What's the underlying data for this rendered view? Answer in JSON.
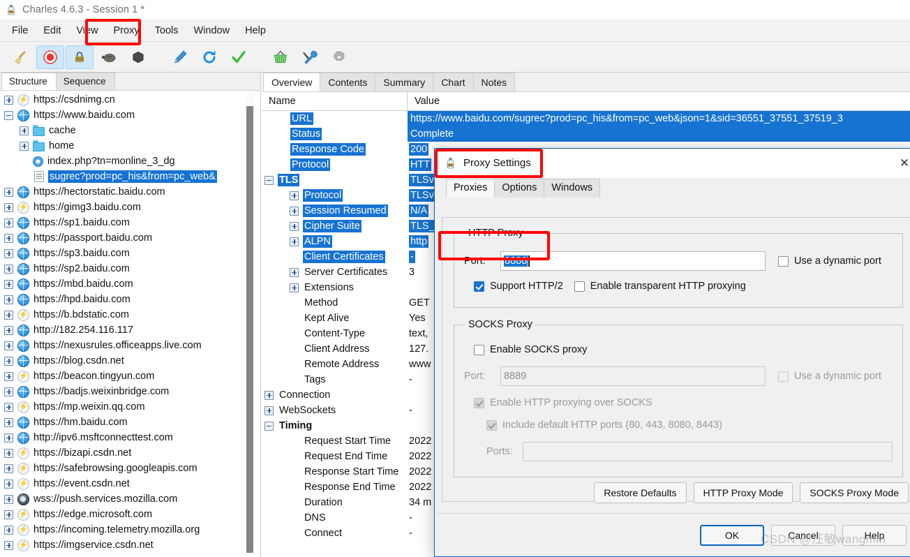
{
  "window": {
    "title": "Charles 4.6.3 - Session 1 *",
    "icon": "charles-bottle-icon"
  },
  "menubar": {
    "items": [
      {
        "label": "File",
        "name": "menu-file"
      },
      {
        "label": "Edit",
        "name": "menu-edit"
      },
      {
        "label": "View",
        "name": "menu-view"
      },
      {
        "label": "Proxy",
        "name": "menu-proxy",
        "highlighted": true
      },
      {
        "label": "Tools",
        "name": "menu-tools"
      },
      {
        "label": "Window",
        "name": "menu-window"
      },
      {
        "label": "Help",
        "name": "menu-help"
      }
    ]
  },
  "toolbar": {
    "buttons": [
      {
        "icon": "broom-icon",
        "glyph": "🧹",
        "active": false
      },
      {
        "icon": "record-icon",
        "glyph": "⏺",
        "active": true
      },
      {
        "icon": "ssl-lock-icon",
        "glyph": "🔒",
        "active": true
      },
      {
        "icon": "throttle-turtle-icon",
        "glyph": "🐢",
        "active": false
      },
      {
        "icon": "breakpoint-hexagon-icon",
        "glyph": "⬣",
        "active": false
      },
      {
        "icon": "compose-pen-icon",
        "glyph": "🖊",
        "active": false
      },
      {
        "icon": "repeat-refresh-icon",
        "glyph": "⟳",
        "active": false
      },
      {
        "icon": "validate-check-icon",
        "glyph": "✔",
        "active": false
      },
      {
        "icon": "basket-icon",
        "glyph": "🧺",
        "active": false
      },
      {
        "icon": "tools-wrench-icon",
        "glyph": "🛠",
        "active": false
      },
      {
        "icon": "settings-gear-icon",
        "glyph": "⚙",
        "active": false
      }
    ]
  },
  "left_panel": {
    "tabs": [
      {
        "label": "Structure",
        "selected": true
      },
      {
        "label": "Sequence",
        "selected": false
      }
    ],
    "tree": [
      {
        "label": "https://csdnimg.cn",
        "indent": 0,
        "twisty": "plus",
        "icon": "bolt",
        "selected": false
      },
      {
        "label": "https://www.baidu.com",
        "indent": 0,
        "twisty": "minus",
        "icon": "globe",
        "selected": false
      },
      {
        "label": "cache",
        "indent": 1,
        "twisty": "plus",
        "icon": "folder",
        "selected": false
      },
      {
        "label": "home",
        "indent": 1,
        "twisty": "plus",
        "icon": "folder",
        "selected": false
      },
      {
        "label": "index.php?tn=monline_3_dg",
        "indent": 1,
        "twisty": "none",
        "icon": "cd",
        "selected": false
      },
      {
        "label": "sugrec?prod=pc_his&from=pc_web&",
        "indent": 1,
        "twisty": "none",
        "icon": "doc",
        "selected": true
      },
      {
        "label": "https://hectorstatic.baidu.com",
        "indent": 0,
        "twisty": "plus",
        "icon": "globe",
        "selected": false
      },
      {
        "label": "https://gimg3.baidu.com",
        "indent": 0,
        "twisty": "plus",
        "icon": "bolt",
        "selected": false
      },
      {
        "label": "https://sp1.baidu.com",
        "indent": 0,
        "twisty": "plus",
        "icon": "globe",
        "selected": false
      },
      {
        "label": "https://passport.baidu.com",
        "indent": 0,
        "twisty": "plus",
        "icon": "globe",
        "selected": false
      },
      {
        "label": "https://sp3.baidu.com",
        "indent": 0,
        "twisty": "plus",
        "icon": "globe",
        "selected": false
      },
      {
        "label": "https://sp2.baidu.com",
        "indent": 0,
        "twisty": "plus",
        "icon": "globe",
        "selected": false
      },
      {
        "label": "https://mbd.baidu.com",
        "indent": 0,
        "twisty": "plus",
        "icon": "globe",
        "selected": false
      },
      {
        "label": "https://hpd.baidu.com",
        "indent": 0,
        "twisty": "plus",
        "icon": "globe",
        "selected": false
      },
      {
        "label": "https://b.bdstatic.com",
        "indent": 0,
        "twisty": "plus",
        "icon": "bolt",
        "selected": false
      },
      {
        "label": "http://182.254.116.117",
        "indent": 0,
        "twisty": "plus",
        "icon": "globe",
        "selected": false
      },
      {
        "label": "https://nexusrules.officeapps.live.com",
        "indent": 0,
        "twisty": "plus",
        "icon": "globe",
        "selected": false
      },
      {
        "label": "https://blog.csdn.net",
        "indent": 0,
        "twisty": "plus",
        "icon": "globe",
        "selected": false
      },
      {
        "label": "https://beacon.tingyun.com",
        "indent": 0,
        "twisty": "plus",
        "icon": "bolt",
        "selected": false
      },
      {
        "label": "https://badjs.weixinbridge.com",
        "indent": 0,
        "twisty": "plus",
        "icon": "globe",
        "selected": false
      },
      {
        "label": "https://mp.weixin.qq.com",
        "indent": 0,
        "twisty": "plus",
        "icon": "bolt",
        "selected": false
      },
      {
        "label": "https://hm.baidu.com",
        "indent": 0,
        "twisty": "plus",
        "icon": "globe",
        "selected": false
      },
      {
        "label": "http://ipv6.msftconnecttest.com",
        "indent": 0,
        "twisty": "plus",
        "icon": "globe",
        "selected": false
      },
      {
        "label": "https://bizapi.csdn.net",
        "indent": 0,
        "twisty": "plus",
        "icon": "bolt",
        "selected": false
      },
      {
        "label": "https://safebrowsing.googleapis.com",
        "indent": 0,
        "twisty": "plus",
        "icon": "bolt",
        "selected": false
      },
      {
        "label": "https://event.csdn.net",
        "indent": 0,
        "twisty": "plus",
        "icon": "bolt",
        "selected": false
      },
      {
        "label": "wss://push.services.mozilla.com",
        "indent": 0,
        "twisty": "plus",
        "icon": "ws",
        "selected": false
      },
      {
        "label": "https://edge.microsoft.com",
        "indent": 0,
        "twisty": "plus",
        "icon": "bolt",
        "selected": false
      },
      {
        "label": "https://incoming.telemetry.mozilla.org",
        "indent": 0,
        "twisty": "plus",
        "icon": "bolt",
        "selected": false
      },
      {
        "label": "https://imgservice.csdn.net",
        "indent": 0,
        "twisty": "plus",
        "icon": "bolt",
        "selected": false
      }
    ]
  },
  "right_panel": {
    "tabs": [
      {
        "label": "Overview",
        "selected": true
      },
      {
        "label": "Contents",
        "selected": false
      },
      {
        "label": "Summary",
        "selected": false
      },
      {
        "label": "Chart",
        "selected": false
      },
      {
        "label": "Notes",
        "selected": false
      }
    ],
    "columns": {
      "name": "Name",
      "value": "Value"
    },
    "rows": [
      {
        "name": "URL",
        "value": "https://www.baidu.com/sugrec?prod=pc_his&from=pc_web&json=1&sid=36551_37551_37519_3",
        "indent": 1,
        "twisty": "none",
        "highlighted": true,
        "bold": false
      },
      {
        "name": "Status",
        "value": "Complete",
        "indent": 1,
        "twisty": "none",
        "highlighted": true,
        "bold": false
      },
      {
        "name": "Response Code",
        "value": "200",
        "indent": 1,
        "twisty": "none",
        "highlighted": true,
        "bold": false
      },
      {
        "name": "Protocol",
        "value": "HTT",
        "indent": 1,
        "twisty": "none",
        "highlighted": true,
        "bold": false
      },
      {
        "name": "TLS",
        "value": "TLSv",
        "indent": 0,
        "twisty": "minus",
        "highlighted": true,
        "bold": true
      },
      {
        "name": "Protocol",
        "value": "TLSv",
        "indent": 2,
        "twisty": "plus",
        "highlighted": true,
        "bold": false
      },
      {
        "name": "Session Resumed",
        "value": "N/A",
        "indent": 2,
        "twisty": "plus",
        "highlighted": true,
        "bold": false
      },
      {
        "name": "Cipher Suite",
        "value": "TLS_",
        "indent": 2,
        "twisty": "plus",
        "highlighted": true,
        "bold": false
      },
      {
        "name": "ALPN",
        "value": "http",
        "indent": 2,
        "twisty": "plus",
        "highlighted": true,
        "bold": false
      },
      {
        "name": "Client Certificates",
        "value": "-",
        "indent": 2,
        "twisty": "none",
        "highlighted": true,
        "bold": false
      },
      {
        "name": "Server Certificates",
        "value": "3",
        "indent": 2,
        "twisty": "plus",
        "highlighted": false,
        "bold": false
      },
      {
        "name": "Extensions",
        "value": "",
        "indent": 2,
        "twisty": "plus",
        "highlighted": false,
        "bold": false
      },
      {
        "name": "Method",
        "value": "GET",
        "indent": 2,
        "twisty": "none",
        "highlighted": false,
        "bold": false
      },
      {
        "name": "Kept Alive",
        "value": "Yes",
        "indent": 2,
        "twisty": "none",
        "highlighted": false,
        "bold": false
      },
      {
        "name": "Content-Type",
        "value": "text,",
        "indent": 2,
        "twisty": "none",
        "highlighted": false,
        "bold": false
      },
      {
        "name": "Client Address",
        "value": "127.",
        "indent": 2,
        "twisty": "none",
        "highlighted": false,
        "bold": false
      },
      {
        "name": "Remote Address",
        "value": "www",
        "indent": 2,
        "twisty": "none",
        "highlighted": false,
        "bold": false
      },
      {
        "name": "Tags",
        "value": "-",
        "indent": 2,
        "twisty": "none",
        "highlighted": false,
        "bold": false
      },
      {
        "name": "Connection",
        "value": "",
        "indent": 0,
        "twisty": "plus",
        "highlighted": false,
        "bold": false
      },
      {
        "name": "WebSockets",
        "value": "-",
        "indent": 0,
        "twisty": "plus",
        "highlighted": false,
        "bold": false
      },
      {
        "name": "Timing",
        "value": "",
        "indent": 0,
        "twisty": "minus",
        "highlighted": false,
        "bold": true
      },
      {
        "name": "Request Start Time",
        "value": "2022",
        "indent": 2,
        "twisty": "none",
        "highlighted": false,
        "bold": false
      },
      {
        "name": "Request End Time",
        "value": "2022",
        "indent": 2,
        "twisty": "none",
        "highlighted": false,
        "bold": false
      },
      {
        "name": "Response Start Time",
        "value": "2022",
        "indent": 2,
        "twisty": "none",
        "highlighted": false,
        "bold": false
      },
      {
        "name": "Response End Time",
        "value": "2022",
        "indent": 2,
        "twisty": "none",
        "highlighted": false,
        "bold": false
      },
      {
        "name": "Duration",
        "value": "34 m",
        "indent": 2,
        "twisty": "none",
        "highlighted": false,
        "bold": false
      },
      {
        "name": "DNS",
        "value": "-",
        "indent": 2,
        "twisty": "none",
        "highlighted": false,
        "bold": false
      },
      {
        "name": "Connect",
        "value": "-",
        "indent": 2,
        "twisty": "none",
        "highlighted": false,
        "bold": false
      }
    ]
  },
  "dialog": {
    "title": "Proxy Settings",
    "icon": "charles-bottle-icon",
    "close_label": "✕",
    "tabs": [
      {
        "label": "Proxies",
        "selected": true
      },
      {
        "label": "Options",
        "selected": false
      },
      {
        "label": "Windows",
        "selected": false
      }
    ],
    "http_proxy": {
      "legend": "HTTP Proxy",
      "port_label": "Port:",
      "port_value": "8888",
      "port_selected": true,
      "dynamic_port_label": "Use a dynamic port",
      "dynamic_port_checked": false,
      "support_http2_label": "Support HTTP/2",
      "support_http2_checked": true,
      "transparent_label": "Enable transparent HTTP proxying",
      "transparent_checked": false
    },
    "socks_proxy": {
      "legend": "SOCKS Proxy",
      "enable_label": "Enable SOCKS proxy",
      "enable_checked": false,
      "port_label": "Port:",
      "port_value": "8889",
      "dynamic_port_label": "Use a dynamic port",
      "dynamic_port_checked": false,
      "http_over_socks_label": "Enable HTTP proxying over SOCKS",
      "http_over_socks_checked": true,
      "default_ports_label": "Include default HTTP ports (80, 443, 8080, 8443)",
      "default_ports_checked": true,
      "ports_label": "Ports:",
      "ports_value": ""
    },
    "mode_buttons": [
      {
        "label": "Restore Defaults",
        "name": "restore-defaults-button"
      },
      {
        "label": "HTTP Proxy Mode",
        "name": "http-proxy-mode-button"
      },
      {
        "label": "SOCKS Proxy Mode",
        "name": "socks-proxy-mode-button"
      }
    ],
    "footer_buttons": [
      {
        "label": "OK",
        "name": "ok-button",
        "primary": true
      },
      {
        "label": "Cancel",
        "name": "cancel-button",
        "primary": false
      },
      {
        "label": "Help",
        "name": "help-button",
        "primary": false
      }
    ]
  },
  "annotations": {
    "highlight_color": "#ff0000",
    "boxes": [
      "proxy-menu-highlight",
      "dialog-title-highlight",
      "http-port-highlight"
    ]
  },
  "watermark": {
    "text": "CSDN @汪敏wangmin"
  },
  "colors": {
    "selection_blue": "#1673d2",
    "accent_border": "#0a66c2",
    "annotation_red": "#ff0000"
  }
}
